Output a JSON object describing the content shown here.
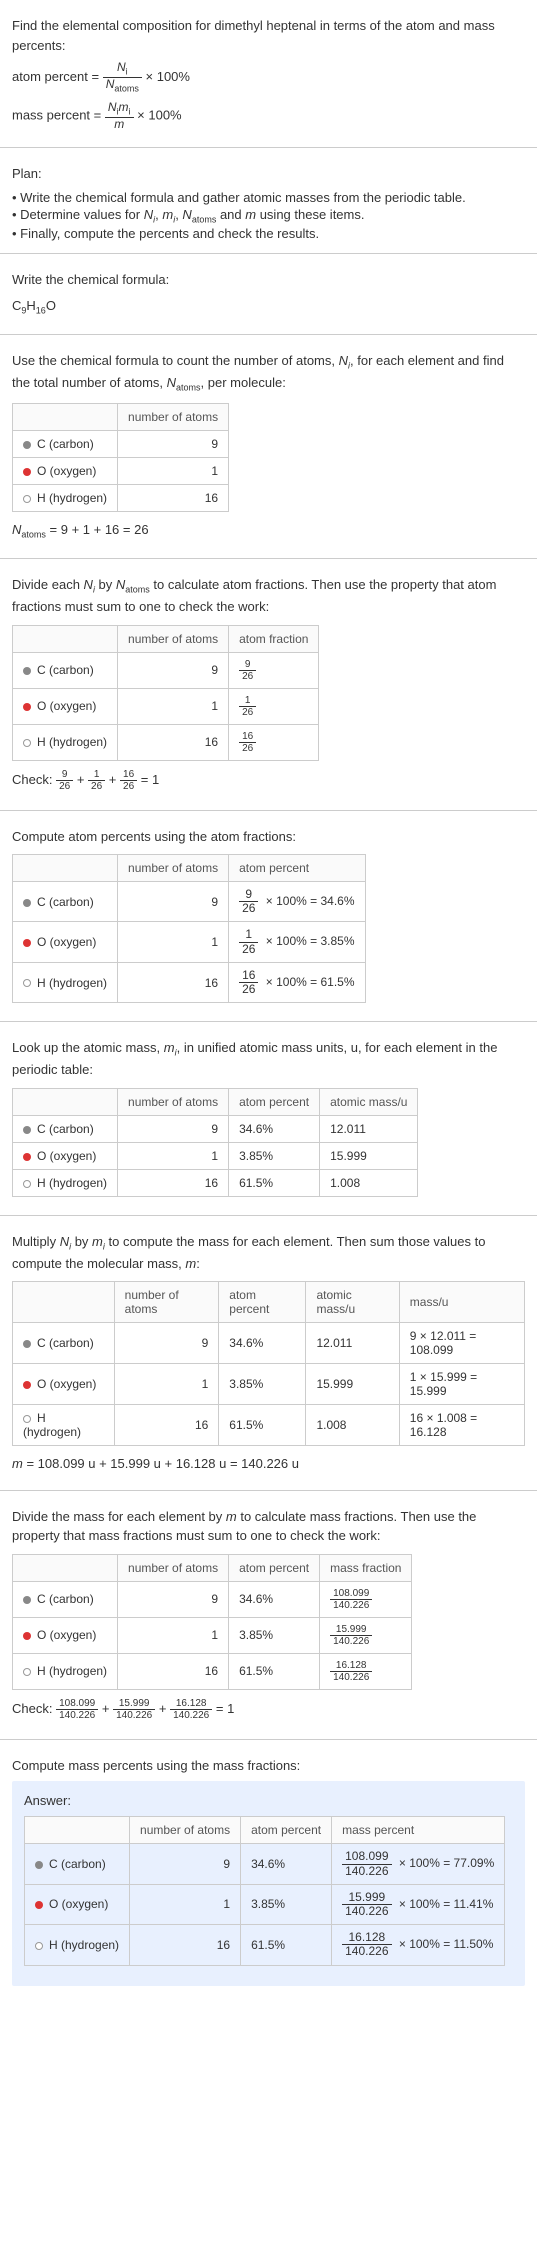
{
  "intro": "Find the elemental composition for dimethyl heptenal in terms of the atom and mass percents:",
  "atom_percent_label": "atom percent = ",
  "atom_percent_frac_num": "N",
  "atom_percent_frac_num_sub": "i",
  "atom_percent_frac_den": "N",
  "atom_percent_frac_den_sub": "atoms",
  "times100": " × 100%",
  "mass_percent_label": "mass percent = ",
  "mass_percent_frac_num": "N",
  "mass_percent_frac_num_sub1": "i",
  "mass_percent_frac_num2": "m",
  "mass_percent_frac_num_sub2": "i",
  "mass_percent_frac_den": "m",
  "plan_label": "Plan:",
  "plan1": "• Write the chemical formula and gather atomic masses from the periodic table.",
  "plan2_pre": "• Determine values for ",
  "plan2_n": "N",
  "plan2_i": "i",
  "plan2_c1": ", ",
  "plan2_m": "m",
  "plan2_c2": ", ",
  "plan2_na": "N",
  "plan2_atoms": "atoms",
  "plan2_c3": " and ",
  "plan2_mm": "m",
  "plan2_post": " using these items.",
  "plan3": "• Finally, compute the percents and check the results.",
  "write_formula": "Write the chemical formula:",
  "chem_formula_c": "C",
  "chem_formula_c_n": "9",
  "chem_formula_h": "H",
  "chem_formula_h_n": "16",
  "chem_formula_o": "O",
  "use_formula": "Use the chemical formula to count the number of atoms, ",
  "use_formula_n": "N",
  "use_formula_i": "i",
  "use_formula_mid": ", for each element and find the total number of atoms, ",
  "use_formula_na": "N",
  "use_formula_atoms": "atoms",
  "use_formula_end": ", per molecule:",
  "th_num_atoms": "number of atoms",
  "th_atom_fraction": "atom fraction",
  "th_atom_percent": "atom percent",
  "th_atomic_mass": "atomic mass/u",
  "th_mass": "mass/u",
  "th_mass_fraction": "mass fraction",
  "th_mass_percent": "mass percent",
  "elements": [
    {
      "name": "C (carbon)",
      "dot": "dot-c",
      "num_atoms": "9",
      "frac_num": "9",
      "frac_den": "26",
      "atom_pct": "34.6%",
      "atomic_mass": "12.011",
      "mass_calc": "9 × 12.011 = 108.099",
      "mass_frac_num": "108.099",
      "mass_frac_den": "140.226",
      "mass_pct": "77.09%",
      "atom_pct_calc_pre": " × 100% = ",
      "atom_pct_val": "34.6%",
      "mass_pct_calc": " × 100% = 77.09%"
    },
    {
      "name": "O (oxygen)",
      "dot": "dot-o",
      "num_atoms": "1",
      "frac_num": "1",
      "frac_den": "26",
      "atom_pct": "3.85%",
      "atomic_mass": "15.999",
      "mass_calc": "1 × 15.999 = 15.999",
      "mass_frac_num": "15.999",
      "mass_frac_den": "140.226",
      "mass_pct": "11.41%",
      "atom_pct_calc_pre": " × 100% = ",
      "atom_pct_val": "3.85%",
      "mass_pct_calc": " × 100% = 11.41%"
    },
    {
      "name": "H (hydrogen)",
      "dot": "dot-h",
      "num_atoms": "16",
      "frac_num": "16",
      "frac_den": "26",
      "atom_pct": "61.5%",
      "atomic_mass": "1.008",
      "mass_calc": "16 × 1.008 = 16.128",
      "mass_frac_num": "16.128",
      "mass_frac_den": "140.226",
      "mass_pct": "11.50%",
      "atom_pct_calc_pre": " × 100% = ",
      "atom_pct_val": "61.5%",
      "mass_pct_calc": " × 100% = 11.50%"
    }
  ],
  "natoms_eq_pre": "N",
  "natoms_eq_sub": "atoms",
  "natoms_eq": " = 9 + 1 + 16 = 26",
  "divide_text_pre": "Divide each ",
  "divide_text_ni_n": "N",
  "divide_text_ni_i": "i",
  "divide_text_mid": " by ",
  "divide_text_na_n": "N",
  "divide_text_na_a": "atoms",
  "divide_text_post": " to calculate atom fractions. Then use the property that atom fractions must sum to one to check the work:",
  "check_label": "Check: ",
  "check_atom_eq": " = 1",
  "compute_atom_pct": "Compute atom percents using the atom fractions:",
  "lookup_pre": "Look up the atomic mass, ",
  "lookup_m": "m",
  "lookup_i": "i",
  "lookup_post": ", in unified atomic mass units, u, for each element in the periodic table:",
  "multiply_pre": "Multiply ",
  "multiply_ni_n": "N",
  "multiply_ni_i": "i",
  "multiply_mid": " by ",
  "multiply_mi_m": "m",
  "multiply_mi_i": "i",
  "multiply_post": " to compute the mass for each element. Then sum those values to compute the molecular mass, ",
  "multiply_m": "m",
  "multiply_end": ":",
  "m_eq_pre": "m",
  "m_eq": " = 108.099 u + 15.999 u + 16.128 u = 140.226 u",
  "divide_mass_pre": "Divide the mass for each element by ",
  "divide_mass_m": "m",
  "divide_mass_post": " to calculate mass fractions. Then use the property that mass fractions must sum to one to check the work:",
  "compute_mass_pct": "Compute mass percents using the mass fractions:",
  "answer_label": "Answer:",
  "plus": " + ",
  "check_mass_eq": " = 1"
}
